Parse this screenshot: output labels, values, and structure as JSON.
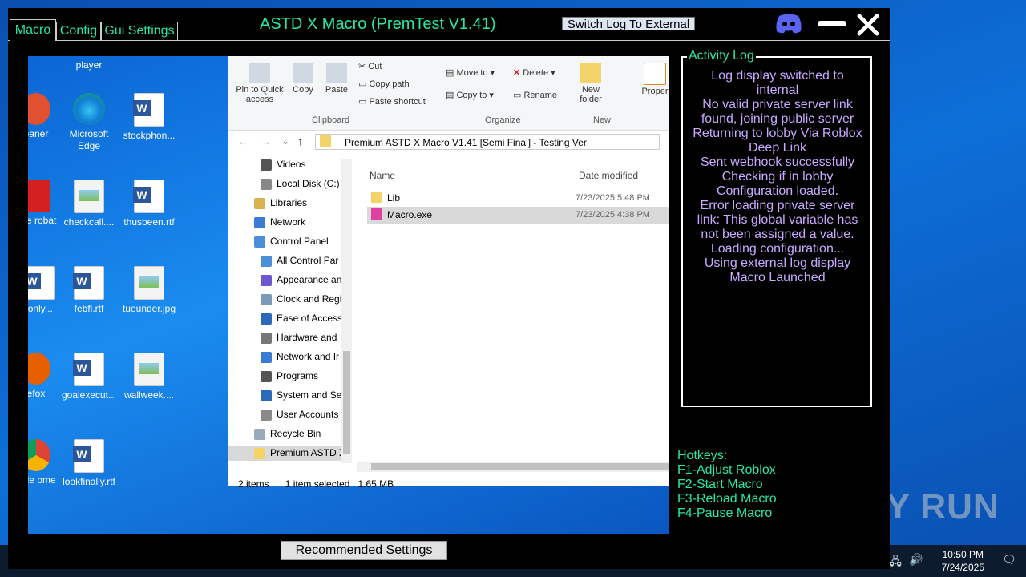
{
  "window": {
    "title": "ASTD X Macro (PremTest V1.41)",
    "tabs": [
      "Macro",
      "Config",
      "Gui Settings"
    ],
    "switch_log_label": "Switch Log To External",
    "recommended_label": "Recommended Settings",
    "accent_color": "#27e6a7",
    "log_color": "#c9a8ff"
  },
  "activity_log": {
    "title": "Activity Log",
    "lines": [
      "Log display switched to internal",
      "No valid private server link found, joining public server",
      "Returning to lobby Via Roblox Deep Link",
      "Sent webhook successfully",
      "Checking if in lobby",
      "Configuration loaded.",
      "Error loading private server link: This global variable has not been assigned a value.",
      "Loading configuration...",
      "Using external log display",
      "Macro Launched"
    ]
  },
  "hotkeys": {
    "title": "Hotkeys:",
    "items": [
      "F1-Adjust Roblox",
      "F2-Start Macro",
      "F3-Reload Macro",
      "F4-Pause Macro"
    ]
  },
  "desktop": {
    "icons": [
      {
        "label": "player",
        "type": "none"
      },
      {
        "label": "eaner",
        "type": "round"
      },
      {
        "label": "Microsoft Edge",
        "type": "edge"
      },
      {
        "label": "stockphon...",
        "type": "word"
      },
      {
        "label": "obe robat",
        "type": "round"
      },
      {
        "label": "checkcall....",
        "type": "pic"
      },
      {
        "label": "thusbeen.rtf",
        "type": "word"
      },
      {
        "label": "lonly...",
        "type": "word"
      },
      {
        "label": "febfi.rtf",
        "type": "word"
      },
      {
        "label": "tueunder.jpg",
        "type": "pic"
      },
      {
        "label": "efox",
        "type": "round"
      },
      {
        "label": "goalexecut...",
        "type": "word"
      },
      {
        "label": "wallweek....",
        "type": "pic"
      },
      {
        "label": "ngle ome",
        "type": "round"
      },
      {
        "label": "lookfinally.rtf",
        "type": "word"
      }
    ]
  },
  "explorer": {
    "ribbon": {
      "pin": "Pin to Quick access",
      "copy": "Copy",
      "paste": "Paste",
      "cut": "Cut",
      "copy_path": "Copy path",
      "paste_shortcut": "Paste shortcut",
      "clipboard": "Clipboard",
      "move_to": "Move to",
      "copy_to": "Copy to",
      "delete": "Delete",
      "rename": "Rename",
      "organize": "Organize",
      "new_folder": "New folder",
      "new": "New",
      "properties": "Proper"
    },
    "address": "Premium ASTD X Macro V1.41 [Semi Final] - Testing Ver",
    "nav": [
      "Videos",
      "Local Disk (C:)",
      "Libraries",
      "Network",
      "Control Panel",
      "All Control Par",
      "Appearance an",
      "Clock and Regi",
      "Ease of Access",
      "Hardware and",
      "Network and Ir",
      "Programs",
      "System and Se",
      "User Accounts",
      "Recycle Bin",
      "Premium ASTD X"
    ],
    "columns": {
      "name": "Name",
      "date": "Date modified"
    },
    "files": [
      {
        "name": "Lib",
        "date": "7/23/2025 5:48 PM"
      },
      {
        "name": "Macro.exe",
        "date": "7/23/2025 4:38 PM"
      }
    ],
    "status": {
      "count": "2 items",
      "selected": "1 item selected",
      "size": "1.65 MB"
    }
  },
  "tray": {
    "time": "10:50 PM",
    "date": "7/24/2025"
  },
  "watermark": "ANY RUN"
}
